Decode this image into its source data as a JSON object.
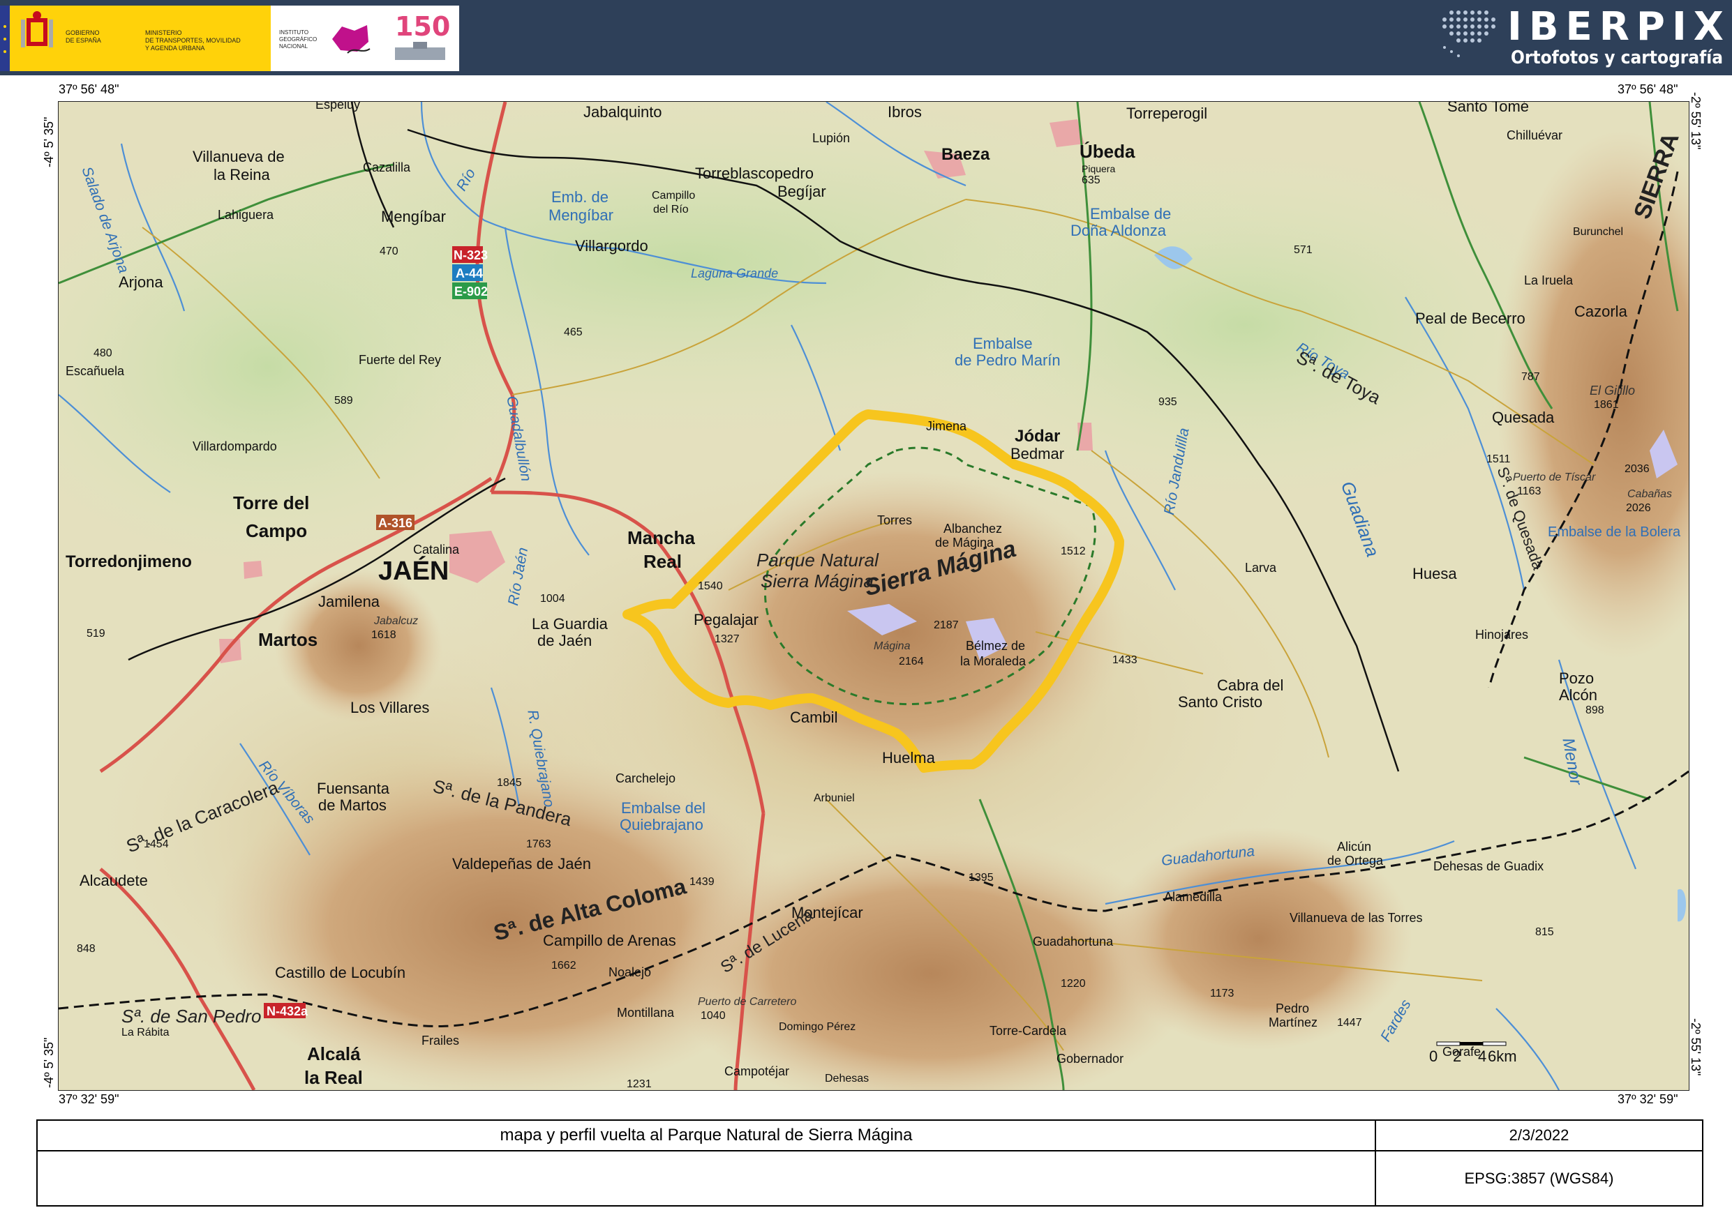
{
  "header": {
    "ministry_lines": [
      "GOBIERNO",
      "DE ESPAÑA"
    ],
    "ministry_name_lines": [
      "MINISTERIO",
      "DE TRANSPORTES, MOVILIDAD",
      "Y AGENDA URBANA"
    ],
    "ign_lines": [
      "INSTITUTO",
      "GEOGRÁFICO",
      "NACIONAL"
    ],
    "anniversary_number": "150",
    "app_title": "IBERPIX",
    "app_subtitle": "Ortofotos y cartografía",
    "colors": {
      "bar": "#2e4059",
      "flag_yellow": "#ffd20a",
      "flag_red": "#c60b1e"
    }
  },
  "coordinates": {
    "top_left_lat": "37º 56' 48\"",
    "top_right_lat": "37º 56' 48\"",
    "bottom_left_lat": "37º 32' 59\"",
    "bottom_right_lat": "37º 32' 59\"",
    "left_top_lon": "-4º 5' 35\"",
    "left_bottom_lon": "-4º 5' 35\"",
    "right_top_lon": "-2º 55' 13\"",
    "right_bottom_lon": "-2º 55' 13\""
  },
  "map": {
    "towns": [
      {
        "name": "Jabalquinto"
      },
      {
        "name": "Ibros"
      },
      {
        "name": "Torreperogil"
      },
      {
        "name": "Santo Tomé"
      },
      {
        "name": "Lupión"
      },
      {
        "name": "Baeza"
      },
      {
        "name": "Úbeda"
      },
      {
        "name": "Chilluévar"
      },
      {
        "name": "Villanueva de"
      },
      {
        "name": "la Reina"
      },
      {
        "name": "Cazalilla"
      },
      {
        "name": "Torreblascopedro"
      },
      {
        "name": "Begíjar"
      },
      {
        "name": "Lahiguera"
      },
      {
        "name": "Mengíbar"
      },
      {
        "name": "Campillo"
      },
      {
        "name": "del Río"
      },
      {
        "name": "Villargordo"
      },
      {
        "name": "Burunchel"
      },
      {
        "name": "Arjona"
      },
      {
        "name": "La Iruela"
      },
      {
        "name": "Peal de Becerro"
      },
      {
        "name": "Cazorla"
      },
      {
        "name": "Escañuela"
      },
      {
        "name": "Fuerte del Rey"
      },
      {
        "name": "Jimena"
      },
      {
        "name": "Jódar"
      },
      {
        "name": "Bedmar"
      },
      {
        "name": "Quesada"
      },
      {
        "name": "Villardompardo"
      },
      {
        "name": "Torres"
      },
      {
        "name": "Albanchez"
      },
      {
        "name": "de Mágina"
      },
      {
        "name": "Torre del"
      },
      {
        "name": "Campo"
      },
      {
        "name": "Mancha"
      },
      {
        "name": "Real"
      },
      {
        "name": "Catalina"
      },
      {
        "name": "Torredonjimeno"
      },
      {
        "name": "Larva"
      },
      {
        "name": "Huesa"
      },
      {
        "name": "Jamilena"
      },
      {
        "name": "Pegalajar"
      },
      {
        "name": "La Guardia"
      },
      {
        "name": "de Jaén"
      },
      {
        "name": "Martos"
      },
      {
        "name": "Bélmez de"
      },
      {
        "name": "la Moraleda"
      },
      {
        "name": "Hinojares"
      },
      {
        "name": "Cabra del"
      },
      {
        "name": "Santo Cristo"
      },
      {
        "name": "Los Villares"
      },
      {
        "name": "Cambil"
      },
      {
        "name": "Pozo"
      },
      {
        "name": "Alcón"
      },
      {
        "name": "Huelma"
      },
      {
        "name": "Carchelejo"
      },
      {
        "name": "Fuensanta"
      },
      {
        "name": "de Martos"
      },
      {
        "name": "Arbuniel"
      },
      {
        "name": "Valdepeñas de Jaén"
      },
      {
        "name": "Alicún"
      },
      {
        "name": "de Ortega"
      },
      {
        "name": "Dehesas de Guadix"
      },
      {
        "name": "Alcaudete"
      },
      {
        "name": "Alamedilla"
      },
      {
        "name": "Montejícar"
      },
      {
        "name": "Villanueva de las Torres"
      },
      {
        "name": "Guadahortuna"
      },
      {
        "name": "Campillo de Arenas"
      },
      {
        "name": "Noalejo"
      },
      {
        "name": "Castillo de Locubín"
      },
      {
        "name": "La Rábita"
      },
      {
        "name": "Montillana"
      },
      {
        "name": "Pedro"
      },
      {
        "name": "Martínez"
      },
      {
        "name": "Domingo Pérez"
      },
      {
        "name": "Torre-Cardela"
      },
      {
        "name": "Frailes"
      },
      {
        "name": "Alcalá"
      },
      {
        "name": "la Real"
      },
      {
        "name": "Gobernador"
      },
      {
        "name": "Gorafe"
      },
      {
        "name": "Campotéjar"
      },
      {
        "name": "Dehesas"
      },
      {
        "name": "Espeluy"
      }
    ],
    "city": "JAÉN",
    "water": [
      {
        "name": "Emb. de"
      },
      {
        "name": "Mengíbar"
      },
      {
        "name": "Laguna Grande"
      },
      {
        "name": "Embalse de"
      },
      {
        "name": "Doña Aldonza"
      },
      {
        "name": "Embalse"
      },
      {
        "name": "de Pedro Marín"
      },
      {
        "name": "Embalse del"
      },
      {
        "name": "Quiebrajano"
      },
      {
        "name": "Embalse de la Bolera"
      }
    ],
    "rivers": [
      {
        "name": "Río"
      },
      {
        "name": "Guadalbullón"
      },
      {
        "name": "Río Jaén"
      },
      {
        "name": "R. Quiebrajano"
      },
      {
        "name": "Río Jandulilla"
      },
      {
        "name": "Guadiana"
      },
      {
        "name": "Guadahortuna"
      },
      {
        "name": "Río Víboras"
      },
      {
        "name": "Salado de Arjona"
      },
      {
        "name": "Río Toya"
      },
      {
        "name": "Menor"
      },
      {
        "name": "Fardes"
      }
    ],
    "ranges": [
      {
        "name": "Sª. de Toya"
      },
      {
        "name": "Sª. de Quesada"
      },
      {
        "name": "Sierra Mágina"
      },
      {
        "name": "Sª. de la Caracolera"
      },
      {
        "name": "Sª. de la Pandera"
      },
      {
        "name": "Sª. de Alta Coloma"
      },
      {
        "name": "Sª. de Lucena"
      },
      {
        "name": "Sª. de San Pedro"
      },
      {
        "name": "SIERRA"
      }
    ],
    "park_label_lines": [
      "Parque Natural",
      "Sierra Mágina"
    ],
    "peaks": [
      {
        "label": "635",
        "name": "Piquera"
      },
      {
        "label": "470"
      },
      {
        "label": "465"
      },
      {
        "label": "571"
      },
      {
        "label": "480"
      },
      {
        "label": "589"
      },
      {
        "label": "935"
      },
      {
        "label": "787"
      },
      {
        "label": "1861",
        "name": "El Gilillo"
      },
      {
        "label": "1511"
      },
      {
        "label": "1163",
        "name": "Puerto de Tíscar"
      },
      {
        "label": "2036"
      },
      {
        "label": "2026",
        "name": "Cabañas"
      },
      {
        "label": "1512"
      },
      {
        "label": "1540"
      },
      {
        "label": "1004"
      },
      {
        "label": "519"
      },
      {
        "label": "1618",
        "name": "Jabalcuz"
      },
      {
        "label": "1327"
      },
      {
        "label": "2187"
      },
      {
        "label": "2164",
        "name": "Mágina"
      },
      {
        "label": "1433"
      },
      {
        "label": "898"
      },
      {
        "label": "1845"
      },
      {
        "label": "1763"
      },
      {
        "label": "1454"
      },
      {
        "label": "1439"
      },
      {
        "label": "1395"
      },
      {
        "label": "815"
      },
      {
        "label": "848"
      },
      {
        "label": "1662"
      },
      {
        "label": "1220"
      },
      {
        "label": "1173"
      },
      {
        "label": "1447"
      },
      {
        "label": "1040",
        "name": "Puerto de Carretero"
      },
      {
        "label": "1231"
      }
    ],
    "road_badges": [
      "N-323",
      "A-44",
      "E-902",
      "A-316",
      "N-432a"
    ],
    "scale": {
      "labels": [
        "0",
        "2",
        "4",
        "6km"
      ]
    },
    "colors": {
      "route": "#f7c51e",
      "roads_main": "#d8524a",
      "roads_secondary": "#c9a33a",
      "rivers": "#4d8fd6",
      "park_boundary": "#2a7a2a"
    }
  },
  "footer": {
    "title": "mapa y perfil vuelta al Parque Natural de Sierra Mágina",
    "date": "2/3/2022",
    "epsg": "EPSG:3857 (WGS84)"
  }
}
